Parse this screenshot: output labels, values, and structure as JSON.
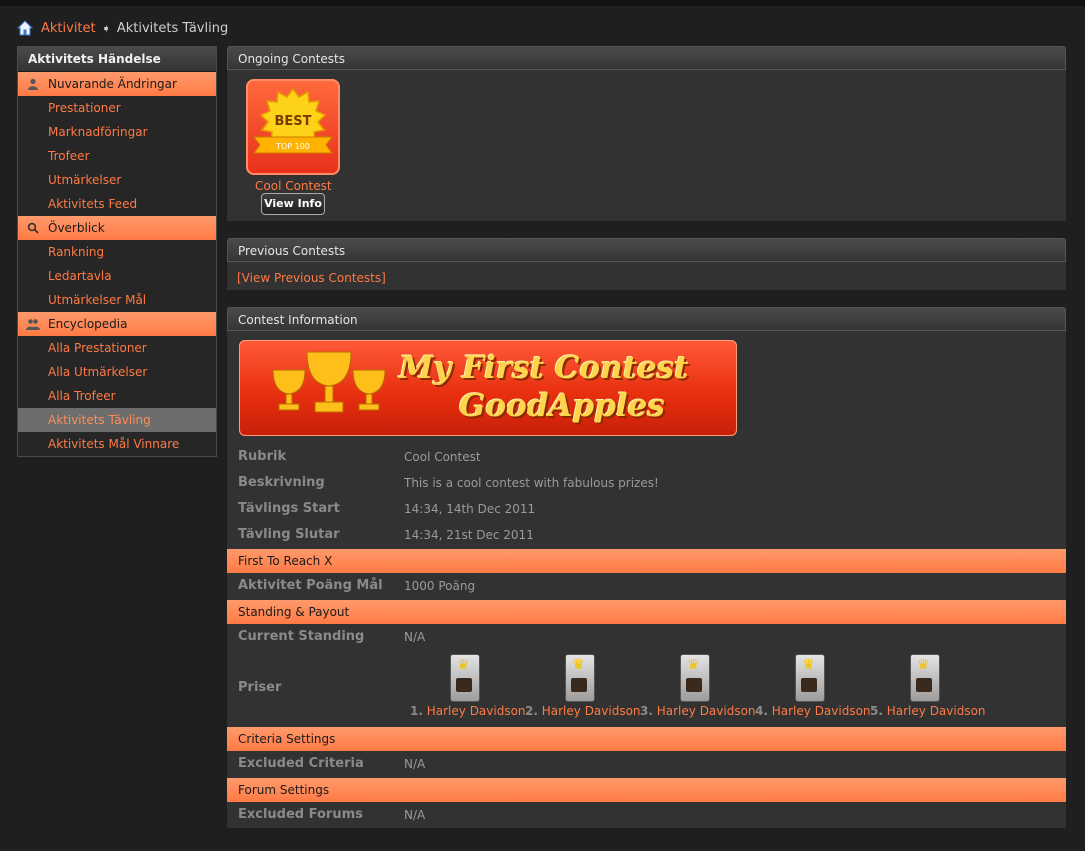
{
  "breadcrumb": {
    "home": "Aktivitet",
    "current": "Aktivitets Tävling"
  },
  "sidebar": {
    "title": "Aktivitets Händelse",
    "groups": [
      {
        "label": "Nuvarande Ändringar",
        "icon": "user-icon",
        "items": [
          "Prestationer",
          "Marknadföringar",
          "Trofeer",
          "Utmärkelser",
          "Aktivitets Feed"
        ]
      },
      {
        "label": "Överblick",
        "icon": "search-icon",
        "items": [
          "Rankning",
          "Ledartavla",
          "Utmärkelser Mål"
        ]
      },
      {
        "label": "Encyclopedia",
        "icon": "users-icon",
        "items": [
          "Alla Prestationer",
          "Alla Utmärkelser",
          "Alla Trofeer",
          "Aktivitets Tävling",
          "Aktivitets Mål Vinnare"
        ]
      }
    ],
    "active_item": "Aktivitets Tävling"
  },
  "ongoing": {
    "title": "Ongoing Contests",
    "contest_name": "Cool Contest",
    "view_label": "View Info",
    "badge_text": "BEST",
    "badge_sub": "TOP 100"
  },
  "previous": {
    "title": "Previous Contests",
    "link": "[View Previous Contests]"
  },
  "info": {
    "title": "Contest Information",
    "banner_line1": "My First Contest",
    "banner_line2": "GoodApples",
    "rows": {
      "rubrik": {
        "label": "Rubrik",
        "value": "Cool Contest"
      },
      "beskrivning": {
        "label": "Beskrivning",
        "value": "This is a cool contest with fabulous prizes!"
      },
      "start": {
        "label": "Tävlings Start",
        "value": "14:34, 14th Dec 2011"
      },
      "slut": {
        "label": "Tävling Slutar",
        "value": "14:34, 21st Dec 2011"
      }
    },
    "section_first": "First To Reach X",
    "goal": {
      "label": "Aktivitet Poäng Mål",
      "value": "1000 Poäng"
    },
    "section_standing": "Standing & Payout",
    "standing": {
      "label": "Current Standing",
      "value": "N/A"
    },
    "prizes_label": "Priser",
    "prizes": [
      {
        "num": "1.",
        "name": "Harley Davidson"
      },
      {
        "num": "2.",
        "name": "Harley Davidson"
      },
      {
        "num": "3.",
        "name": "Harley Davidson"
      },
      {
        "num": "4.",
        "name": "Harley Davidson"
      },
      {
        "num": "5.",
        "name": "Harley Davidson"
      }
    ],
    "section_criteria": "Criteria Settings",
    "excluded_criteria": {
      "label": "Excluded Criteria",
      "value": "N/A"
    },
    "section_forum": "Forum Settings",
    "excluded_forums": {
      "label": "Excluded Forums",
      "value": "N/A"
    }
  },
  "colors": {
    "accent": "#ff7a45",
    "background": "#1f1f1f",
    "panel": "#323232"
  }
}
